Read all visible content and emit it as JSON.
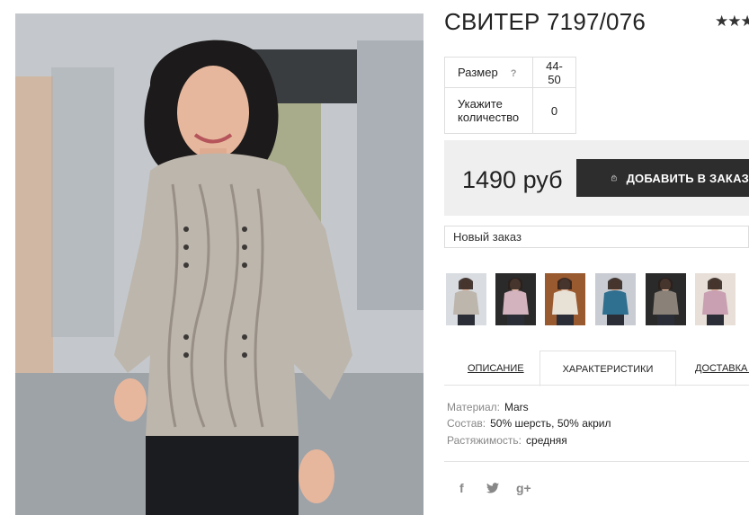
{
  "product": {
    "title": "СВИТЕР 7197/076",
    "rating_stars": "★★★"
  },
  "params": {
    "size_label": "Размер",
    "size_help": "?",
    "size_value": "44-50",
    "qty_label": "Укажите количество",
    "qty_value": "0"
  },
  "purchase": {
    "price": "1490 руб",
    "add_button_label": "ДОБАВИТЬ В ЗАКАЗ",
    "order_select_value": "Новый заказ"
  },
  "thumbnails": [
    {
      "sweater": "#bdb6ad",
      "bg": "#d9dde1"
    },
    {
      "sweater": "#d3b3bd",
      "bg": "#2a2a2a"
    },
    {
      "sweater": "#e8e1d6",
      "bg": "#9a5a30"
    },
    {
      "sweater": "#2f6f8f",
      "bg": "#c9ccd2"
    },
    {
      "sweater": "#8a8279",
      "bg": "#2a2a2a"
    },
    {
      "sweater": "#c9a0b1",
      "bg": "#e8e0d8"
    }
  ],
  "tabs": [
    {
      "label": "Описание"
    },
    {
      "label": "Характеристики"
    },
    {
      "label": "Доставка и"
    }
  ],
  "specs": [
    {
      "key": "Материал:",
      "value": "Mars"
    },
    {
      "key": "Состав:",
      "value": "50% шерсть, 50% акрил"
    },
    {
      "key": "Растяжимость:",
      "value": "средняя"
    }
  ],
  "social": [
    "f",
    "twitter-bird",
    "g+"
  ],
  "social_text": {
    "facebook": "f",
    "gplus": "g+"
  },
  "colors": {
    "accent_dark": "#2d2d2d",
    "price_bg": "#efefef",
    "border": "#dedede"
  }
}
